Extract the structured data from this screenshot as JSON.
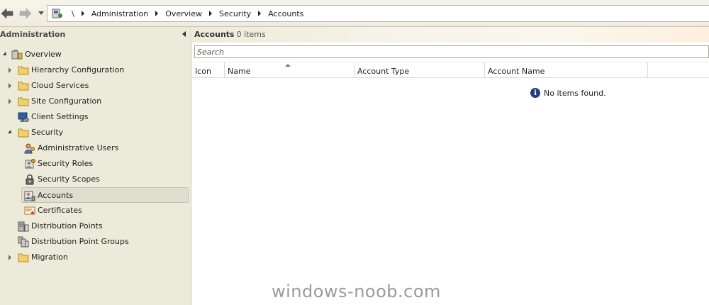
{
  "address_bar": {
    "separator": "\\",
    "breadcrumb": [
      "Administration",
      "Overview",
      "Security",
      "Accounts"
    ]
  },
  "nav": {
    "header": "Administration",
    "tree": [
      {
        "label": "Overview",
        "icon": "overview-icon",
        "expanded": true
      },
      {
        "label": "Hierarchy Configuration",
        "icon": "folder-icon"
      },
      {
        "label": "Cloud Services",
        "icon": "folder-icon"
      },
      {
        "label": "Site Configuration",
        "icon": "folder-icon"
      },
      {
        "label": "Client Settings",
        "icon": "client-settings-icon"
      },
      {
        "label": "Security",
        "icon": "folder-icon",
        "expanded": true
      },
      {
        "label": "Administrative Users",
        "icon": "admin-users-icon"
      },
      {
        "label": "Security Roles",
        "icon": "security-roles-icon"
      },
      {
        "label": "Security Scopes",
        "icon": "security-scopes-icon"
      },
      {
        "label": "Accounts",
        "icon": "accounts-icon",
        "selected": true
      },
      {
        "label": "Certificates",
        "icon": "certificate-icon"
      },
      {
        "label": "Distribution Points",
        "icon": "distribution-points-icon"
      },
      {
        "label": "Distribution Point Groups",
        "icon": "distribution-point-groups-icon"
      },
      {
        "label": "Migration",
        "icon": "folder-icon"
      }
    ]
  },
  "content": {
    "title": "Accounts",
    "count": "0 items",
    "search_placeholder": "Search",
    "columns": [
      "Icon",
      "Name",
      "Account Type",
      "Account Name"
    ],
    "empty_message": "No items found."
  },
  "watermark": "windows-noob.com",
  "colors": {
    "nav_background": "#ecebd9",
    "folder": "#e8c25a",
    "info_icon": "#24407a"
  }
}
